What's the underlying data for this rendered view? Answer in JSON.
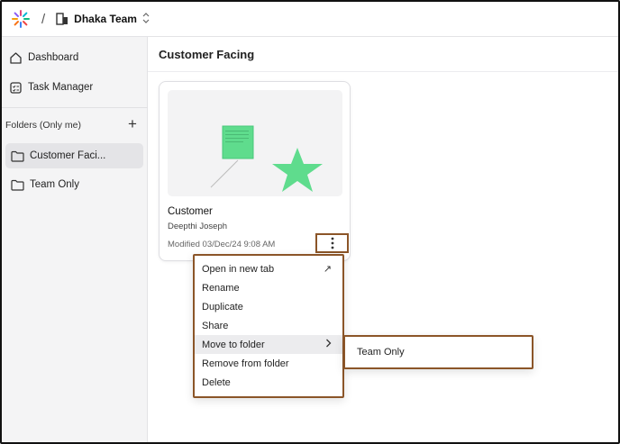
{
  "topbar": {
    "separator": "/",
    "team_name": "Dhaka Team",
    "switcher_glyph": "⌃⌄"
  },
  "sidebar": {
    "nav": [
      {
        "label": "Dashboard",
        "icon": "home-icon"
      },
      {
        "label": "Task Manager",
        "icon": "checklist-icon"
      }
    ],
    "folders_heading": "Folders (Only me)",
    "add_glyph": "+",
    "folders": [
      {
        "label": "Customer Faci...",
        "active": true
      },
      {
        "label": "Team Only",
        "active": false
      }
    ]
  },
  "main": {
    "title": "Customer Facing",
    "card": {
      "title": "Customer",
      "owner": "Deepthi Joseph",
      "modified": "Modified 03/Dec/24 9:08 AM",
      "more_glyph": "⋮"
    }
  },
  "context_menu": {
    "items": [
      {
        "label": "Open in new tab",
        "glyph": "↗"
      },
      {
        "label": "Rename",
        "glyph": ""
      },
      {
        "label": "Duplicate",
        "glyph": ""
      },
      {
        "label": "Share",
        "glyph": ""
      },
      {
        "label": "Move to folder",
        "glyph": "›"
      },
      {
        "label": "Remove from folder",
        "glyph": ""
      },
      {
        "label": "Delete",
        "glyph": ""
      }
    ],
    "submenu": {
      "label": "Team Only"
    }
  },
  "colors": {
    "highlight_border": "#8b5528",
    "shape_green": "#5fdc8d"
  }
}
